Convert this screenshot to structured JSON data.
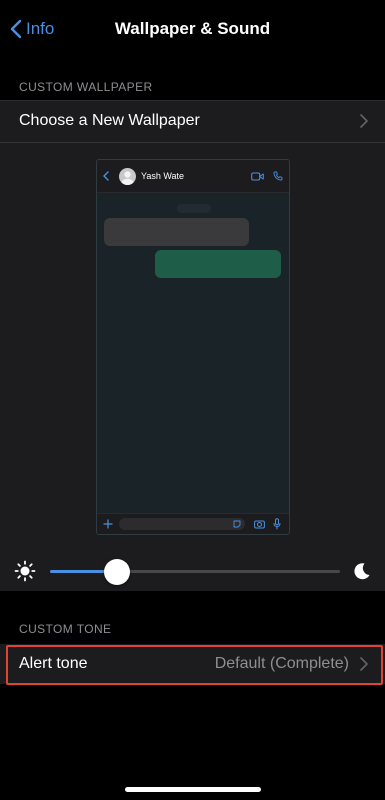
{
  "nav": {
    "back_label": "Info",
    "title": "Wallpaper & Sound"
  },
  "wallpaper": {
    "section_header": "CUSTOM WALLPAPER",
    "choose_label": "Choose a New Wallpaper",
    "preview": {
      "contact_name": "Yash Wate"
    },
    "brightness_fraction": 0.23
  },
  "tone": {
    "section_header": "CUSTOM TONE",
    "alert_label": "Alert tone",
    "alert_value": "Default (Complete)"
  },
  "colors": {
    "accent": "#4a90e2",
    "highlight": "#e0442f",
    "outgoing_bubble": "#1e5e49"
  }
}
